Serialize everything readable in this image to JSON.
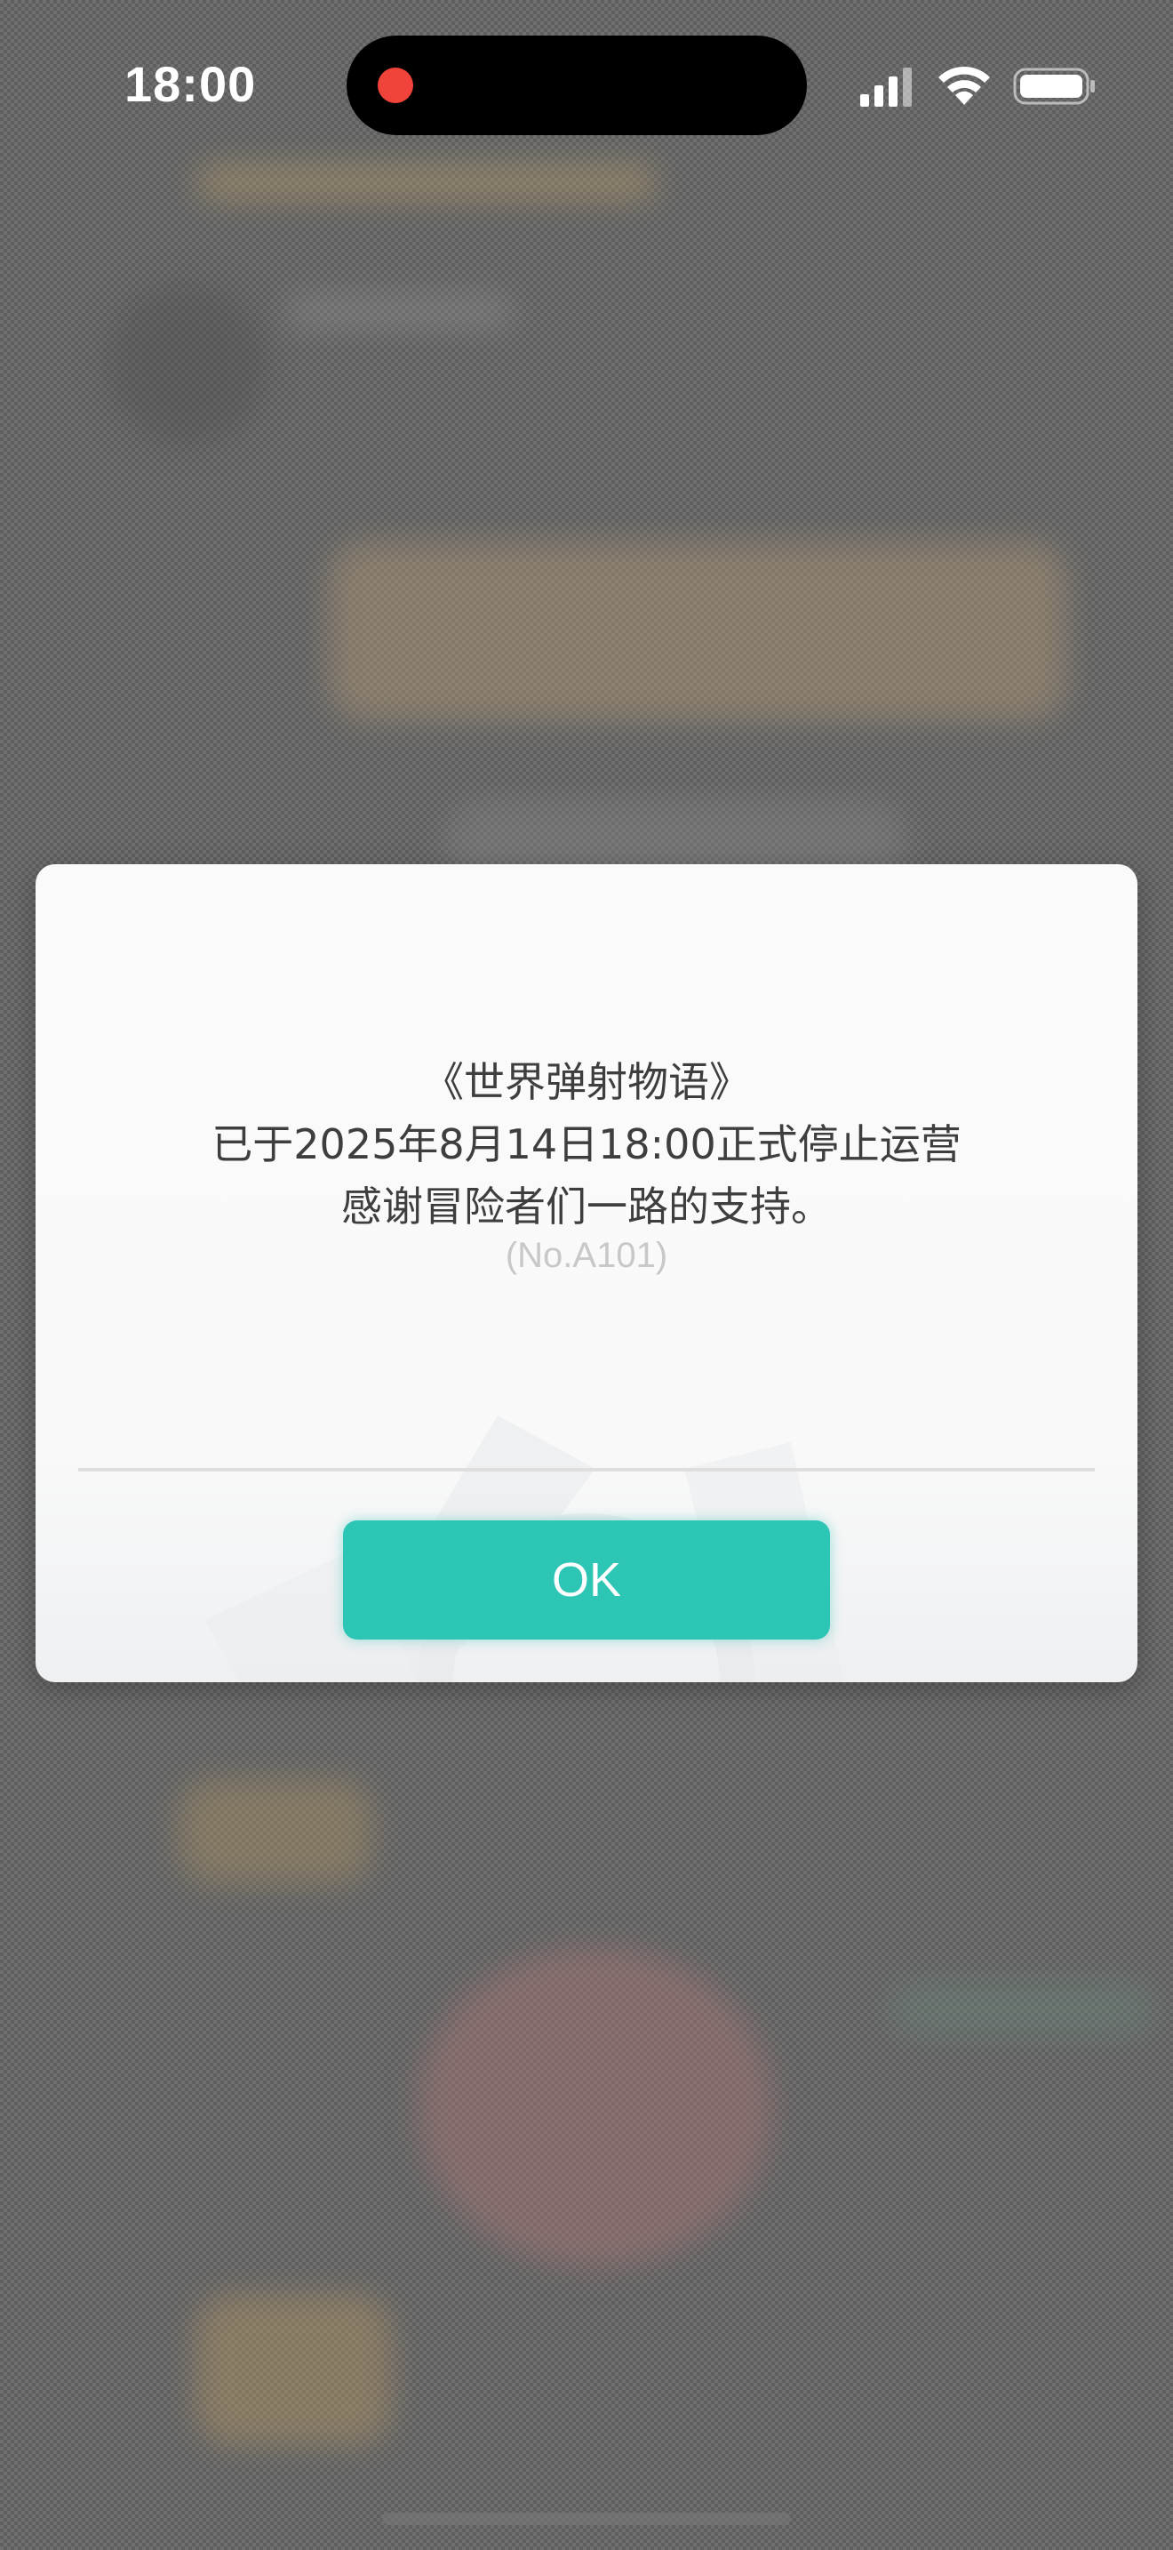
{
  "status_bar": {
    "time": "18:00",
    "icons": [
      "recording-dot",
      "signal-icon",
      "wifi-icon",
      "battery-icon"
    ],
    "record_color": "#f0433a"
  },
  "dialog": {
    "message_lines": [
      "《世界弹射物语》",
      "已于2025年8月14日18:00正式停止运营",
      "感谢冒险者们一路的支持。"
    ],
    "code": "(No.A101)",
    "ok_label": "OK",
    "accent_color": "#2dc6b5"
  }
}
